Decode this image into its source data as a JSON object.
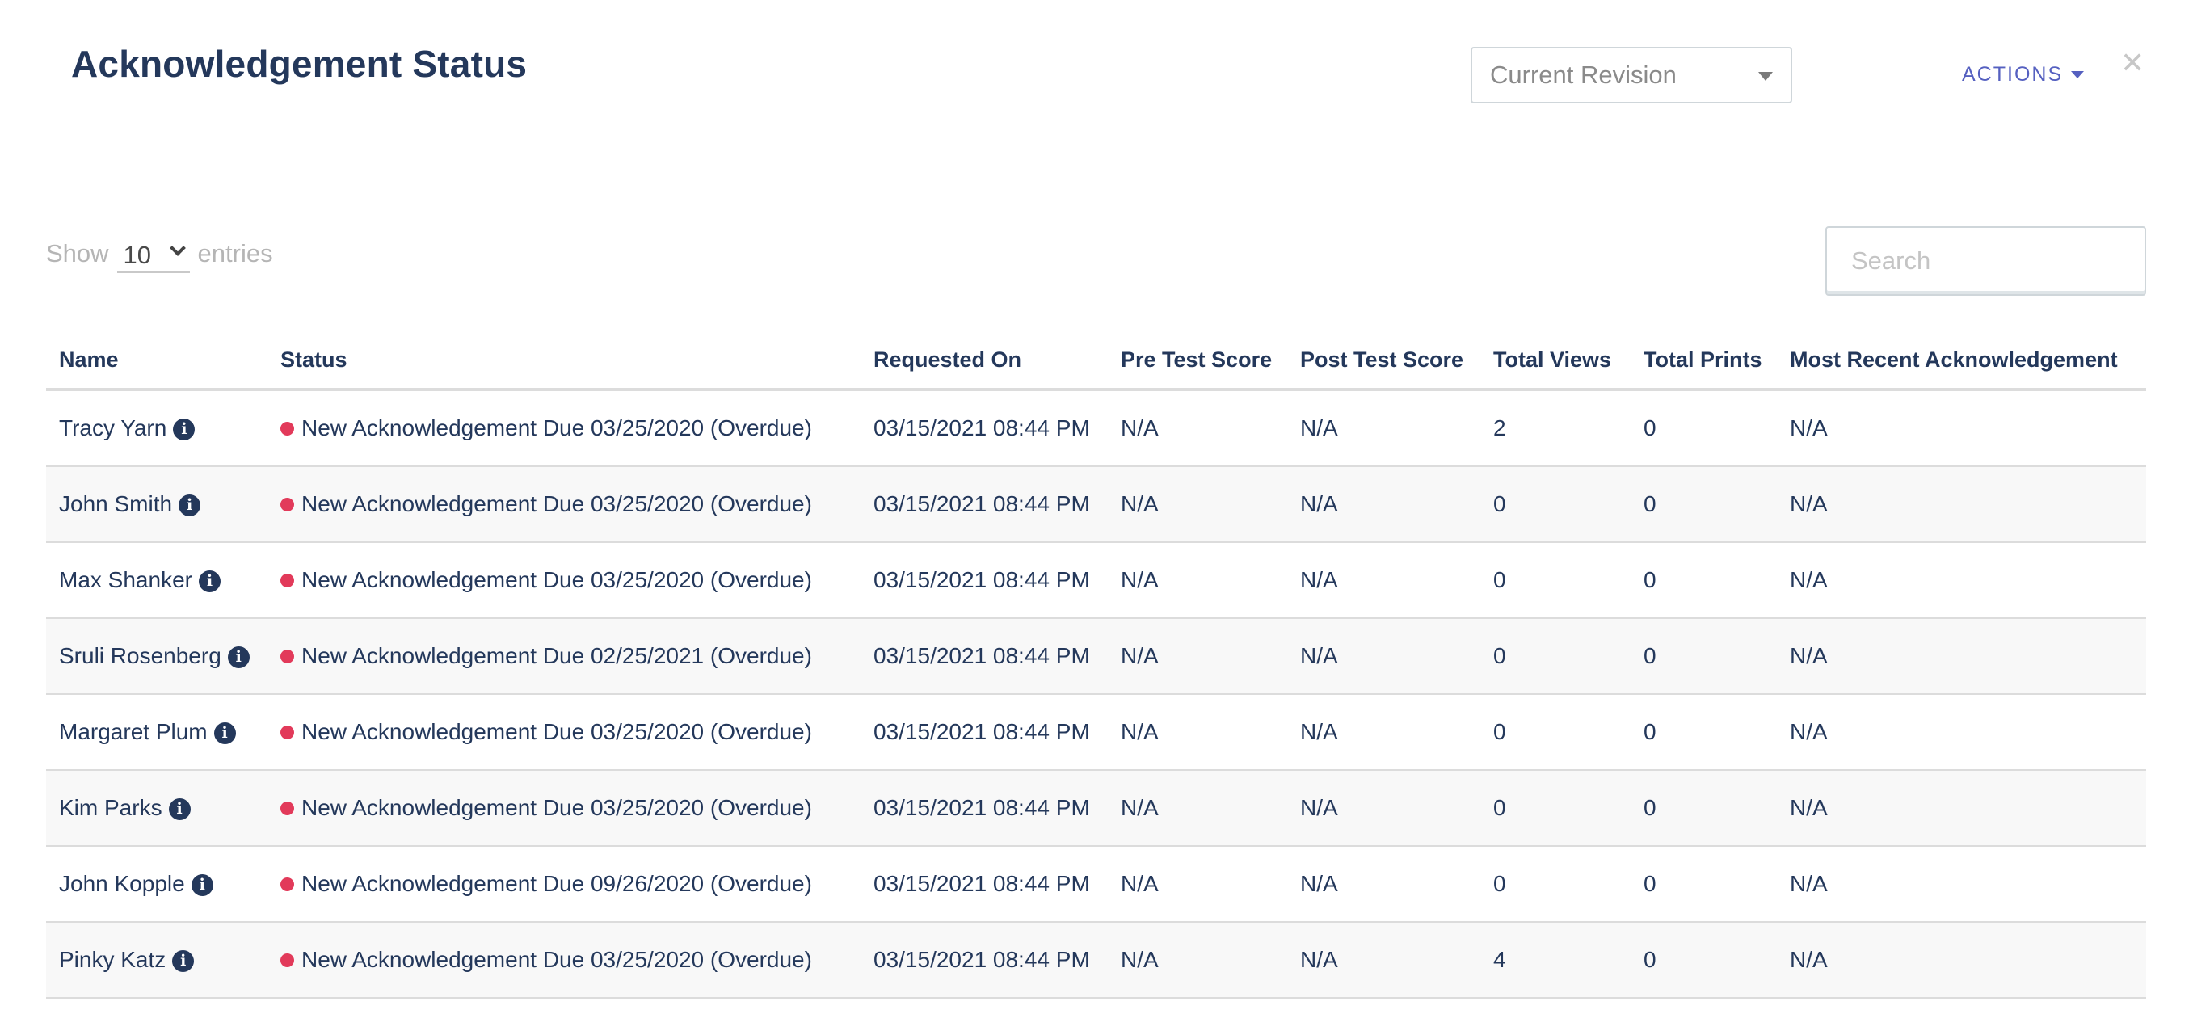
{
  "header": {
    "title": "Acknowledgement Status",
    "revision_select": {
      "selected": "Current Revision"
    },
    "actions_label": "ACTIONS",
    "close_icon": "close-icon"
  },
  "controls": {
    "show_label": "Show",
    "entries_value": "10",
    "entries_label": "entries",
    "search_placeholder": "Search"
  },
  "colors": {
    "primary_text": "#24385b",
    "accent": "#5560c0",
    "status_overdue": "#e23a5a"
  },
  "table": {
    "columns": [
      "Name",
      "Status",
      "Requested On",
      "Pre Test Score",
      "Post Test Score",
      "Total Views",
      "Total Prints",
      "Most Recent Acknowledgement"
    ],
    "rows": [
      {
        "name": "Tracy Yarn",
        "status": "New Acknowledgement Due 03/25/2020 (Overdue)",
        "requested_on": "03/15/2021 08:44 PM",
        "pre_test": "N/A",
        "post_test": "N/A",
        "views": "2",
        "prints": "0",
        "recent": "N/A"
      },
      {
        "name": "John Smith",
        "status": "New Acknowledgement Due 03/25/2020 (Overdue)",
        "requested_on": "03/15/2021 08:44 PM",
        "pre_test": "N/A",
        "post_test": "N/A",
        "views": "0",
        "prints": "0",
        "recent": "N/A"
      },
      {
        "name": "Max Shanker",
        "status": "New Acknowledgement Due 03/25/2020 (Overdue)",
        "requested_on": "03/15/2021 08:44 PM",
        "pre_test": "N/A",
        "post_test": "N/A",
        "views": "0",
        "prints": "0",
        "recent": "N/A"
      },
      {
        "name": "Sruli Rosenberg",
        "status": "New Acknowledgement Due 02/25/2021 (Overdue)",
        "requested_on": "03/15/2021 08:44 PM",
        "pre_test": "N/A",
        "post_test": "N/A",
        "views": "0",
        "prints": "0",
        "recent": "N/A"
      },
      {
        "name": "Margaret Plum",
        "status": "New Acknowledgement Due 03/25/2020 (Overdue)",
        "requested_on": "03/15/2021 08:44 PM",
        "pre_test": "N/A",
        "post_test": "N/A",
        "views": "0",
        "prints": "0",
        "recent": "N/A"
      },
      {
        "name": "Kim Parks",
        "status": "New Acknowledgement Due 03/25/2020 (Overdue)",
        "requested_on": "03/15/2021 08:44 PM",
        "pre_test": "N/A",
        "post_test": "N/A",
        "views": "0",
        "prints": "0",
        "recent": "N/A"
      },
      {
        "name": "John Kopple",
        "status": "New Acknowledgement Due 09/26/2020 (Overdue)",
        "requested_on": "03/15/2021 08:44 PM",
        "pre_test": "N/A",
        "post_test": "N/A",
        "views": "0",
        "prints": "0",
        "recent": "N/A"
      },
      {
        "name": "Pinky Katz",
        "status": "New Acknowledgement Due 03/25/2020 (Overdue)",
        "requested_on": "03/15/2021 08:44 PM",
        "pre_test": "N/A",
        "post_test": "N/A",
        "views": "4",
        "prints": "0",
        "recent": "N/A"
      }
    ]
  }
}
